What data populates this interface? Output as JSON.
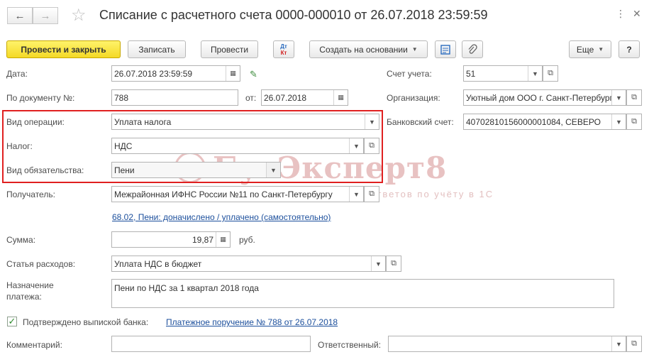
{
  "window": {
    "title": "Списание с расчетного счета 0000-000010 от 26.07.2018 23:59:59",
    "more_icon": "⋮",
    "close_icon": "✕"
  },
  "toolbar": {
    "post_close": "Провести и закрыть",
    "save": "Записать",
    "post": "Провести",
    "dt_kt_top": "Дт",
    "dt_kt_bottom": "Кт",
    "create_based": "Создать на основании",
    "more": "Еще",
    "help": "?"
  },
  "form": {
    "date_label": "Дата:",
    "date_value": "26.07.2018 23:59:59",
    "doc_label": "По документу №:",
    "doc_value": "788",
    "from_label": "от:",
    "from_value": "26.07.2018",
    "account_label": "Счет учета:",
    "account_value": "51",
    "org_label": "Организация:",
    "org_value": "Уютный дом ООО г. Санкт-Петербург",
    "bank_label": "Банковский счет:",
    "bank_value": "40702810156000001084, СЕВЕРО",
    "op_label": "Вид операции:",
    "op_value": "Уплата налога",
    "tax_label": "Налог:",
    "tax_value": "НДС",
    "liability_label": "Вид обязательства:",
    "liability_value": "Пени",
    "recipient_label": "Получатель:",
    "recipient_value": "Межрайонная ИФНС России №11 по Санкт-Петербургу",
    "account_link": "68.02, Пени: доначислено / уплачено (самостоятельно)",
    "sum_label": "Сумма:",
    "sum_value": "19,87",
    "currency": "руб.",
    "expense_label": "Статья расходов:",
    "expense_value": "Уплата НДС в бюджет",
    "purpose_label_1": "Назначение",
    "purpose_label_2": "платежа:",
    "purpose_value": "Пени по НДС за 1 квартал 2018 года",
    "confirmed_label": "Подтверждено выпиской банка:",
    "payment_link": "Платежное поручение № 788 от 26.07.2018",
    "comment_label": "Комментарий:",
    "comment_value": "",
    "responsible_label": "Ответственный:",
    "responsible_value": ""
  },
  "watermark": {
    "big": "БухЭксперт8",
    "small": "База ответов по учёту в 1С"
  }
}
